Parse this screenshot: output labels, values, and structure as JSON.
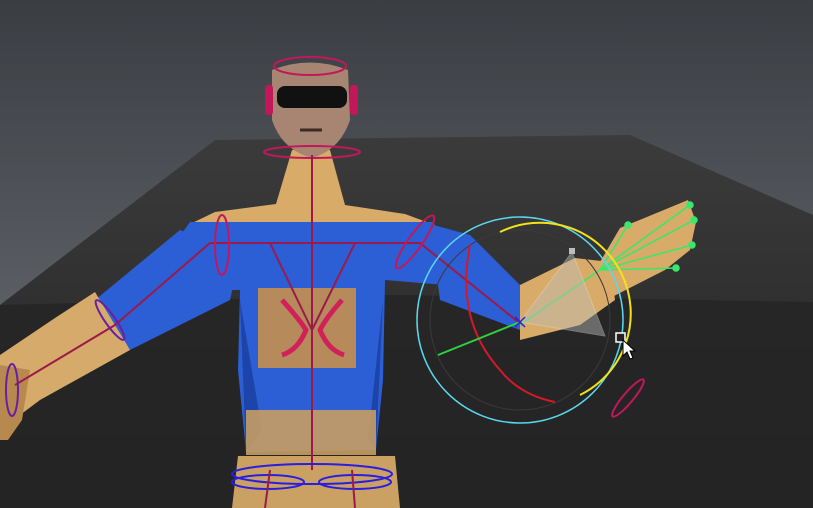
{
  "viewport": {
    "colors": {
      "sky_top": "#3c3f44",
      "sky_bottom": "#6e7379",
      "floor_far": "#3a3a3a",
      "floor_near": "#262626",
      "skin": "#d8ab68",
      "skin_shadow": "#a9793f",
      "shirt": "#2c5fd6",
      "shirt_dark": "#1c3f9e",
      "chest_patch": "#b68a5a",
      "joint": "#c2185b",
      "joint_purple": "#6b1fa0",
      "ik_green": "#38e86a",
      "manip_cyan": "#5ad7ee",
      "manip_yellow": "#f3e21b",
      "manip_red": "#d3192a",
      "manip_axis_green": "#2fd13f",
      "cursor": "#ffffff"
    },
    "icons": {
      "rotate_manipulator": "rotate-manipulator-icon",
      "cursor": "mouse-pointer-icon"
    }
  }
}
